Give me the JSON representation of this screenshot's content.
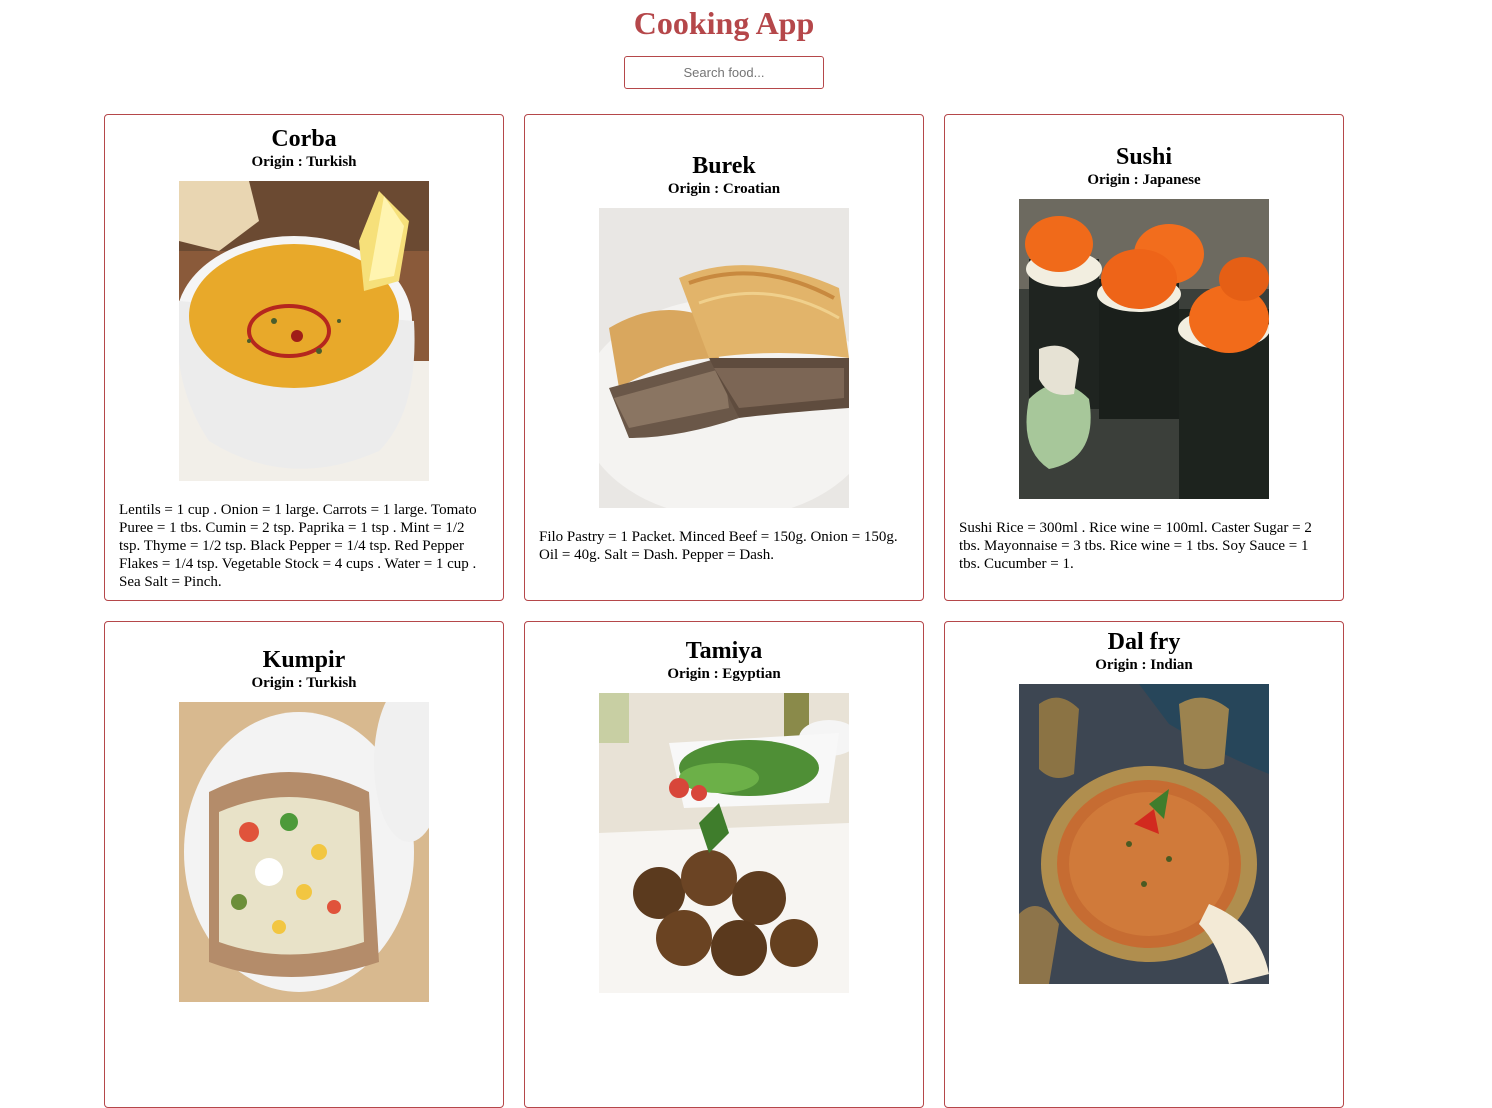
{
  "app": {
    "title": "Cooking App"
  },
  "search": {
    "placeholder": "Search food...",
    "value": ""
  },
  "colors": {
    "accent": "#b5474a"
  },
  "recipes": [
    {
      "name": "Corba",
      "origin": "Origin : Turkish",
      "image": "lentil-soup-photo",
      "ingredients": "Lentils = 1 cup . Onion = 1 large. Carrots = 1 large. Tomato Puree = 1 tbs. Cumin = 2 tsp. Paprika = 1 tsp . Mint = 1/2 tsp. Thyme = 1/2 tsp. Black Pepper = 1/4 tsp. Red Pepper Flakes = 1/4 tsp. Vegetable Stock = 4 cups . Water = 1 cup . Sea Salt = Pinch."
    },
    {
      "name": "Burek",
      "origin": "Origin : Croatian",
      "image": "burek-pastry-photo",
      "ingredients": "Filo Pastry = 1 Packet. Minced Beef = 150g. Onion = 150g. Oil = 40g. Salt = Dash. Pepper = Dash."
    },
    {
      "name": "Sushi",
      "origin": "Origin : Japanese",
      "image": "sushi-rolls-photo",
      "ingredients": "Sushi Rice = 300ml . Rice wine = 100ml. Caster Sugar = 2 tbs. Mayonnaise = 3 tbs. Rice wine = 1 tbs. Soy Sauce = 1 tbs. Cucumber = 1."
    },
    {
      "name": "Kumpir",
      "origin": "Origin : Turkish",
      "image": "stuffed-potato-photo",
      "ingredients": ""
    },
    {
      "name": "Tamiya",
      "origin": "Origin : Egyptian",
      "image": "falafel-plate-photo",
      "ingredients": ""
    },
    {
      "name": "Dal fry",
      "origin": "Origin : Indian",
      "image": "dal-curry-photo",
      "ingredients": ""
    }
  ]
}
